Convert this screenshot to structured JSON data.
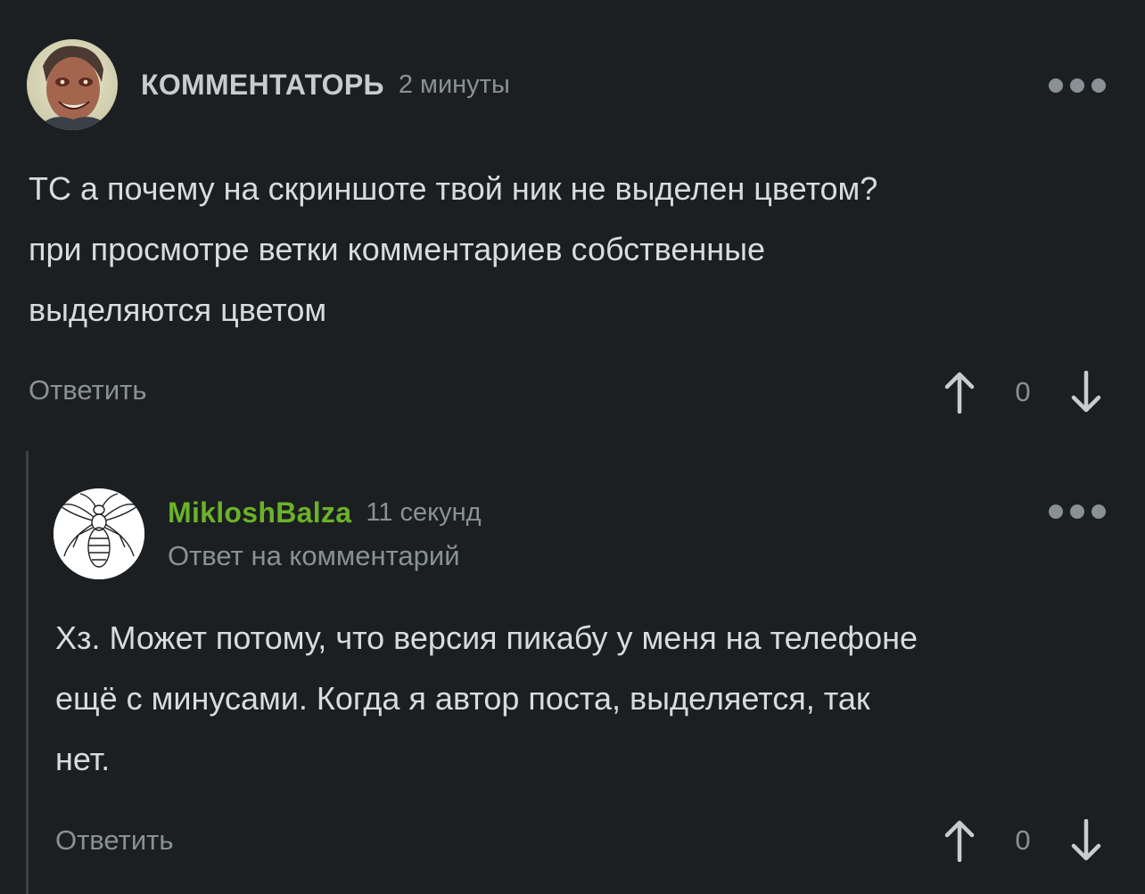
{
  "comments": [
    {
      "username": "КОММЕНТАТОРЬ",
      "time": "2 минуты",
      "avatar_icon": "grinning-man-portrait-avatar",
      "text_lines": [
        "ТС а почему на скриншоте твой ник не выделен цветом?",
        "при просмотре ветки комментариев собственные",
        "выделяются цветом"
      ],
      "reply_label": "Ответить",
      "vote_count": "0",
      "menu_icon": "more-dots-icon"
    },
    {
      "username": "MikloshBalza",
      "time": "11 секунд",
      "subline": "Ответ на комментарий",
      "avatar_icon": "wasp-drawing-avatar",
      "text_lines": [
        "Хз. Может потому, что версия пикабу у меня на телефоне",
        "ещё с минусами. Когда я автор поста, выделяется, так",
        "нет."
      ],
      "reply_label": "Ответить",
      "vote_count": "0",
      "menu_icon": "more-dots-icon"
    }
  ],
  "colors": {
    "background": "#1b1f21",
    "text": "#d9dcde",
    "muted": "#8a9195",
    "own_username": "#6bb228",
    "thread_line": "#3a4044"
  }
}
